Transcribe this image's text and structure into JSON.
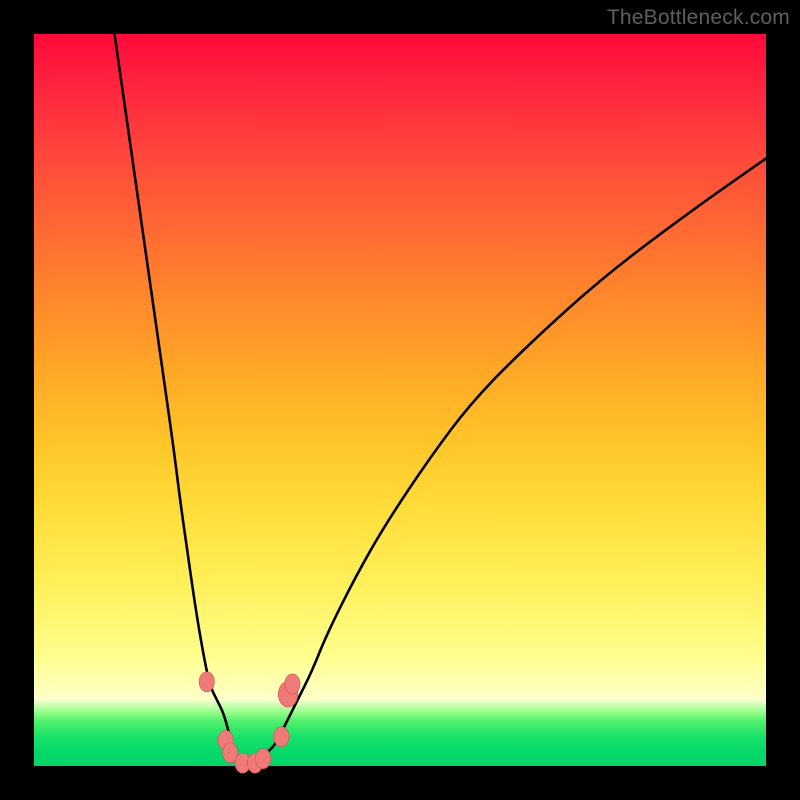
{
  "watermark": "TheBottleneck.com",
  "colors": {
    "frame": "#000000",
    "curve_stroke": "#000000",
    "marker_fill": "#ef7a78",
    "marker_stroke": "#c95553"
  },
  "chart_data": {
    "type": "line",
    "title": "",
    "xlabel": "",
    "ylabel": "",
    "xlim": [
      0,
      100
    ],
    "ylim": [
      0,
      100
    ],
    "note": "No axes or ticks are shown; background gradient encodes severity (red high, green low). Values are estimated from pixel positions.",
    "series": [
      {
        "name": "bottleneck-curve",
        "x": [
          11,
          13,
          15,
          17,
          19,
          20,
          21,
          22,
          23,
          24,
          25,
          26,
          27,
          28,
          29,
          30,
          31,
          32,
          33,
          34,
          36,
          38,
          40,
          44,
          48,
          54,
          60,
          68,
          78,
          90,
          100
        ],
        "y": [
          100,
          86,
          72,
          58,
          44,
          36,
          29,
          22,
          16,
          11,
          9,
          7,
          3,
          1,
          0,
          0,
          1,
          2,
          3,
          5,
          9,
          13,
          18,
          26,
          33,
          42,
          50,
          58,
          67,
          76,
          83
        ]
      }
    ],
    "markers": [
      {
        "x": 23.6,
        "y": 11.5,
        "r": 1.1
      },
      {
        "x": 26.2,
        "y": 3.5,
        "r": 1.1
      },
      {
        "x": 26.8,
        "y": 1.8,
        "r": 1.1
      },
      {
        "x": 28.5,
        "y": 0.4,
        "r": 1.1
      },
      {
        "x": 30.2,
        "y": 0.4,
        "r": 1.1
      },
      {
        "x": 31.3,
        "y": 1.0,
        "r": 1.1
      },
      {
        "x": 33.8,
        "y": 4.0,
        "r": 1.1
      },
      {
        "x": 34.7,
        "y": 9.8,
        "r": 1.4
      },
      {
        "x": 35.3,
        "y": 11.2,
        "r": 1.1
      }
    ]
  }
}
